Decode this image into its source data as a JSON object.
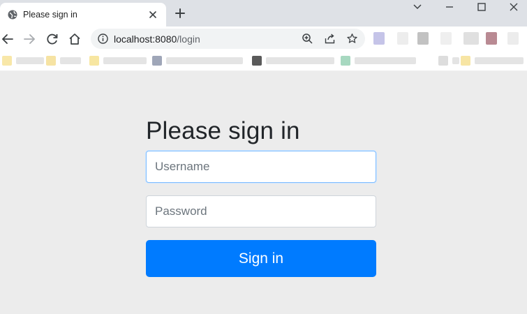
{
  "browser": {
    "tab": {
      "title": "Please sign in"
    },
    "address_bar": {
      "host": "localhost:8080",
      "path": "/login"
    }
  },
  "page": {
    "heading": "Please sign in",
    "username": {
      "placeholder": "Username",
      "value": ""
    },
    "password": {
      "placeholder": "Password",
      "value": ""
    },
    "submit_label": "Sign in"
  },
  "colors": {
    "primary_button": "#007bff",
    "page_background": "#ececec",
    "tab_strip": "#dee1e6"
  },
  "icons": [
    "globe-icon",
    "close-icon",
    "plus-icon",
    "minimize-icon",
    "maximize-icon",
    "chevron-down-icon",
    "back-icon",
    "forward-icon",
    "reload-icon",
    "home-icon",
    "info-icon",
    "zoom-icon",
    "share-icon",
    "star-icon"
  ]
}
